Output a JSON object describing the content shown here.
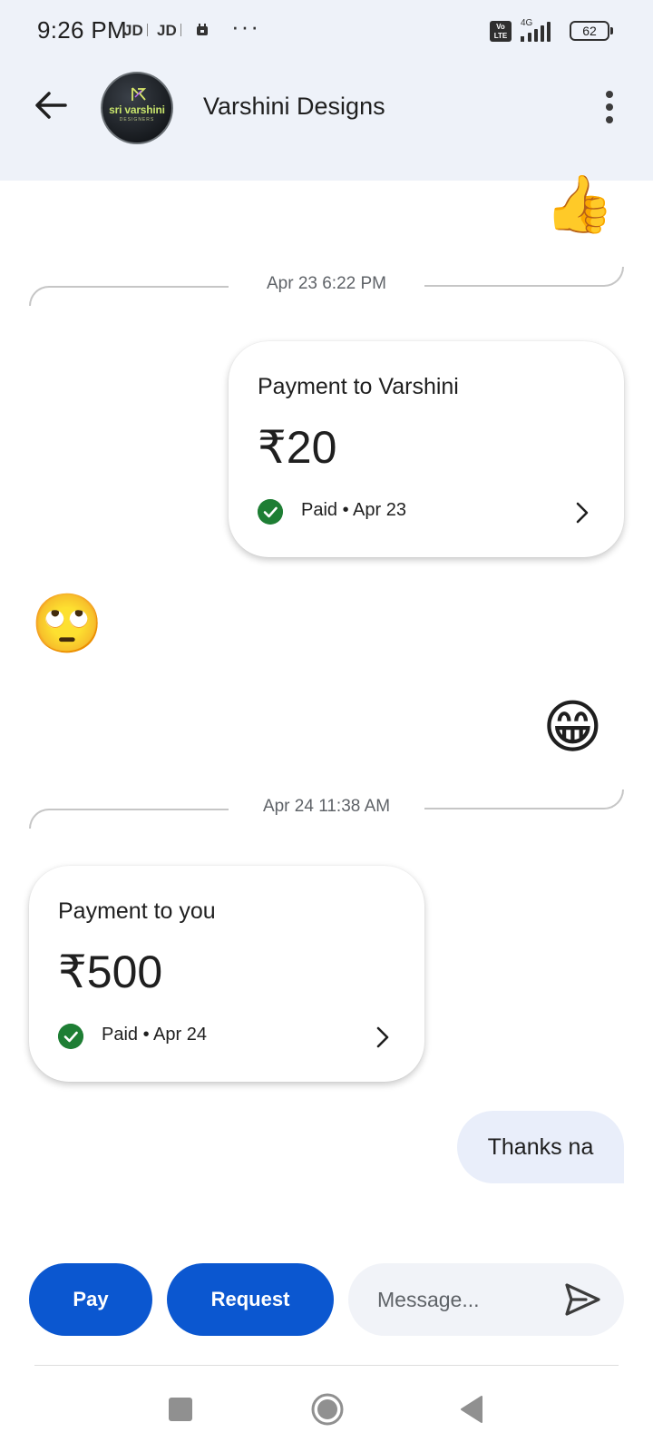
{
  "status_bar": {
    "time": "9:26 PM",
    "apps": [
      "JD",
      "JD"
    ],
    "more": "···",
    "network_badge": "Vo\nLTE",
    "network_type": "4G",
    "battery": "62"
  },
  "header": {
    "contact_name": "Varshini Designs",
    "avatar_text": "sri varshini",
    "avatar_subtext": "DESIGNERS",
    "back_icon": "arrow-left-icon",
    "menu_icon": "more-vertical-icon"
  },
  "messages": {
    "emoji_thumbs": "👍",
    "divider_1": "Apr 23 6:22 PM",
    "card_1": {
      "title": "Payment to Varshini",
      "amount": "₹20",
      "status": "Paid • Apr 23"
    },
    "emoji_eyeroll": "🙄",
    "emoji_grin": "😁",
    "divider_2": "Apr 24 11:38 AM",
    "card_2": {
      "title": "Payment to you",
      "amount": "₹500",
      "status": "Paid • Apr 24"
    },
    "bubble_text": "Thanks na"
  },
  "composer": {
    "pay_label": "Pay",
    "request_label": "Request",
    "message_placeholder": "Message...",
    "send_icon": "send-icon"
  },
  "colors": {
    "header_bg": "#eef2f9",
    "primary": "#0b57d0",
    "paid_green": "#1e7e34",
    "bubble_bg": "#e9eefa"
  }
}
